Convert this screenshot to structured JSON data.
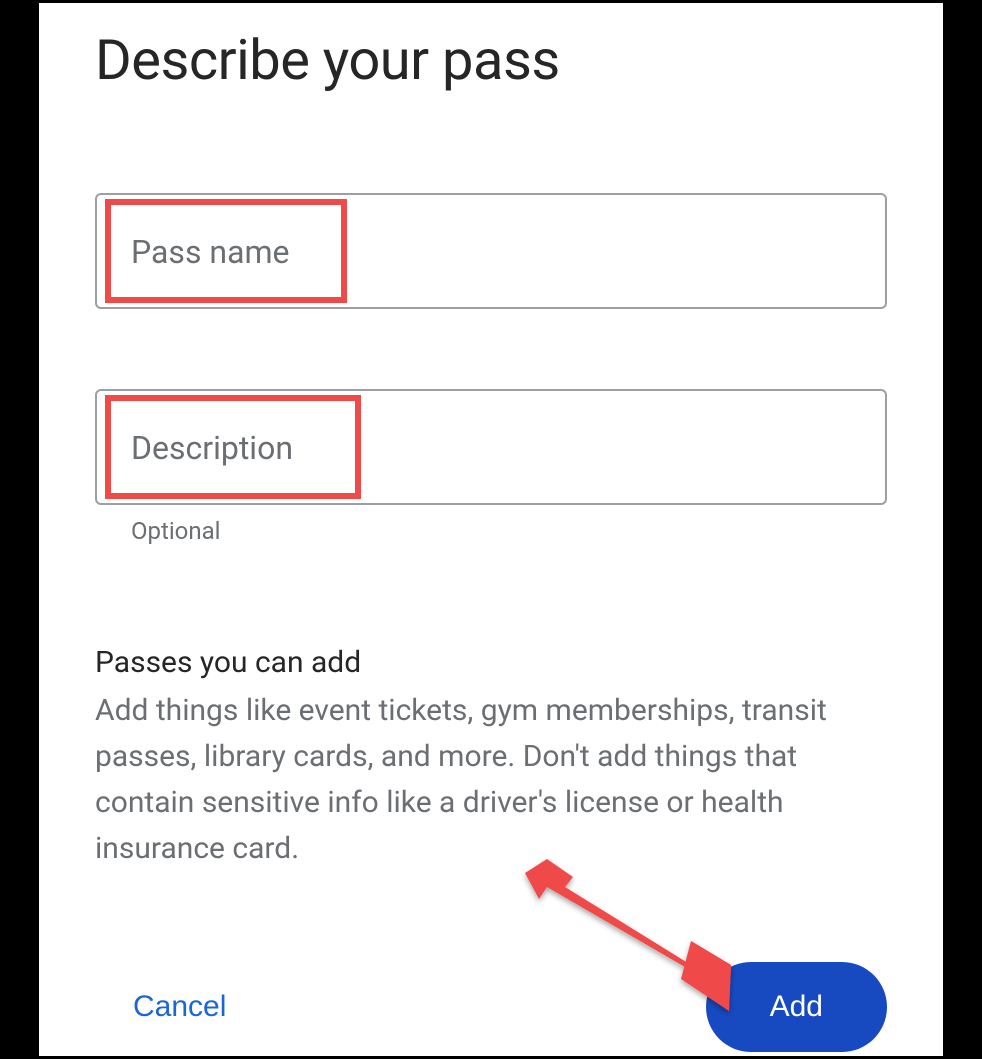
{
  "title": "Describe your pass",
  "fields": {
    "pass_name": {
      "placeholder": "Pass name"
    },
    "description": {
      "placeholder": "Description",
      "hint": "Optional"
    }
  },
  "info": {
    "heading": "Passes you can add",
    "body": "Add things like event tickets, gym memberships, transit passes, library cards, and more. Don't add things that contain sensitive info like a driver's license or health insurance card."
  },
  "buttons": {
    "cancel": "Cancel",
    "add": "Add"
  },
  "annotation": {
    "highlight_color": "#ef4a4a",
    "arrow_color": "#ef4a4a"
  }
}
